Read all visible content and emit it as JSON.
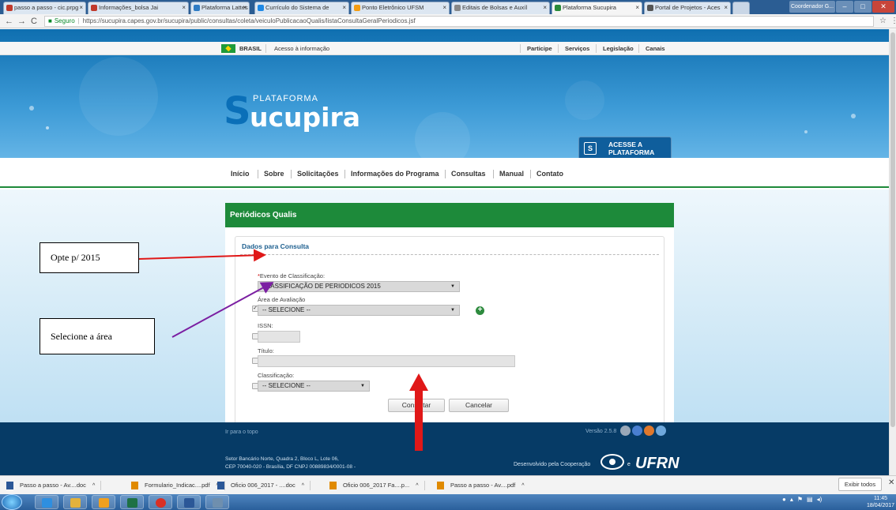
{
  "browser": {
    "tabs": [
      {
        "label": "passo a passo - cic.prpg",
        "color": "#c0392b"
      },
      {
        "label": "Informações_bolsa Jai",
        "color": "#c0392b"
      },
      {
        "label": "Plataforma Lattes",
        "color": "#2e7bc4"
      },
      {
        "label": "Currículo do Sistema de",
        "color": "#1e88e5"
      },
      {
        "label": "Ponto Eletrônico UFSM",
        "color": "#f39c12"
      },
      {
        "label": "Editais de Bolsas e Auxíl",
        "color": "#888888"
      },
      {
        "label": "Plataforma Sucupira",
        "color": "#2a8a3a"
      },
      {
        "label": "Portal de Projetos - Aces",
        "color": "#555555"
      }
    ],
    "user_label": "Coordenador G...",
    "url": {
      "secure_label": "Seguro",
      "text": "https://sucupira.capes.gov.br/sucupira/public/consultas/coleta/veiculoPublicacaoQualis/listaConsultaGeralPeriodicos.jsf"
    }
  },
  "gov_bar": {
    "brasil": "BRASIL",
    "acesso": "Acesso à informação",
    "links": [
      "Participe",
      "Serviços",
      "Legislação",
      "Canais"
    ]
  },
  "logo": {
    "s": "S",
    "plataforma": "PLATAFORMA",
    "ucupira": "ucupira"
  },
  "acesse": {
    "line1": "ACESSE A",
    "line2": "PLATAFORMA",
    "icon": "S"
  },
  "main_nav": [
    "Início",
    "Sobre",
    "Solicitações",
    "Informações do Programa",
    "Consultas",
    "Manual",
    "Contato"
  ],
  "panel": {
    "title": "Periódicos Qualis",
    "form_title": "Dados para Consulta",
    "evento_label": "Evento de Classificação:",
    "evento_value": "CLASSIFICAÇÃO DE PERIODICOS 2015",
    "area_label": "Área de Avaliação",
    "area_value": "-- SELECIONE --",
    "issn_label": "ISSN:",
    "titulo_label": "Título:",
    "classificacao_label": "Classificação:",
    "classificacao_value": "-- SELECIONE --",
    "consultar": "Consultar",
    "cancelar": "Cancelar"
  },
  "footer": {
    "top_link": "Ir para o topo",
    "version": "Versão 2.5.8",
    "address_line1": "Setor Bancário Norte, Quadra 2, Bloco L, Lote 06,",
    "address_line2": "CEP 70040-020 - Brasília, DF CNPJ 00889834/0001-08 -",
    "dev": "Desenvolvido pela Cooperação",
    "e": "e",
    "ufrn": "UFRN"
  },
  "annotations": {
    "callout1": "Opte p/ 2015",
    "callout2": "Selecione a área",
    "arrow_color": "#e01818",
    "arrow2_color": "#7b1fa2"
  },
  "downloads": [
    {
      "label": "Passo a passo - Av....doc",
      "color": "#2b5797"
    },
    {
      "label": "Formulario_Indicac....pdf",
      "color": "#e08a00"
    },
    {
      "label": "Oficio 006_2017 - ....doc",
      "color": "#2b5797"
    },
    {
      "label": "Oficio 006_2017 Fa....p...",
      "color": "#e08a00"
    },
    {
      "label": "Passo a passo - Av....pdf",
      "color": "#e08a00"
    }
  ],
  "downloads_show_all": "Exibir todos",
  "taskbar": {
    "time": "11:45",
    "date": "18/04/2017"
  }
}
